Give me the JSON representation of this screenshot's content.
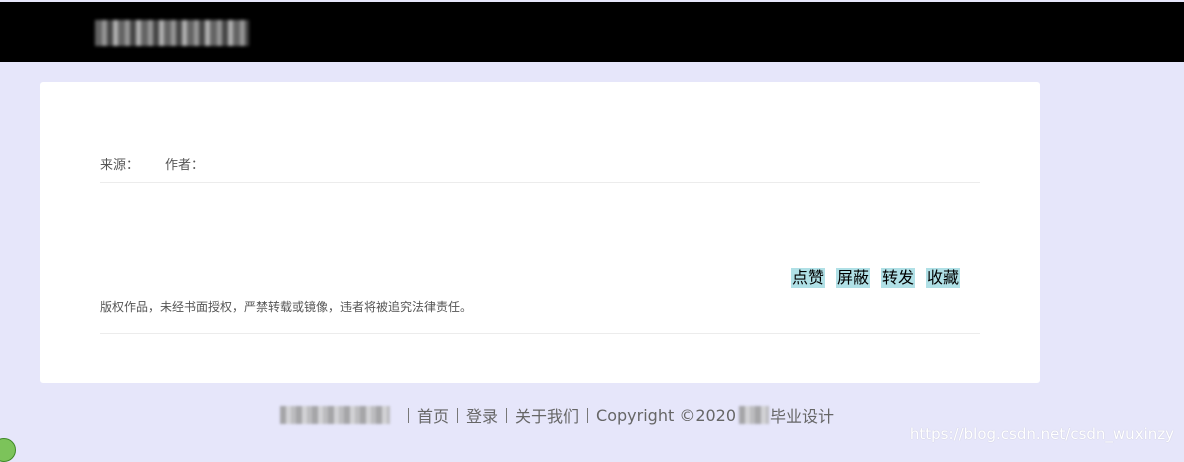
{
  "header": {
    "logo_icon": "site-logo-blurred"
  },
  "article": {
    "source_label": "来源：",
    "author_label": "作者：",
    "copyright_notice": "版权作品，未经书面授权，严禁转载或镜像，违者将被追究法律责任。",
    "actions": [
      {
        "label": "点赞"
      },
      {
        "label": "屏蔽"
      },
      {
        "label": "转发"
      },
      {
        "label": "收藏"
      }
    ]
  },
  "footer": {
    "links": [
      {
        "label": "首页"
      },
      {
        "label": "登录"
      },
      {
        "label": "关于我们"
      }
    ],
    "copyright_prefix": "Copyright ©2020",
    "copyright_suffix": "毕业设计"
  },
  "watermark": "https://blog.csdn.net/csdn_wuxinzy",
  "colors": {
    "header_bg": "#000000",
    "page_bg": "#e6e6fa",
    "card_bg": "#ffffff",
    "action_bg": "#b0e0e6"
  }
}
